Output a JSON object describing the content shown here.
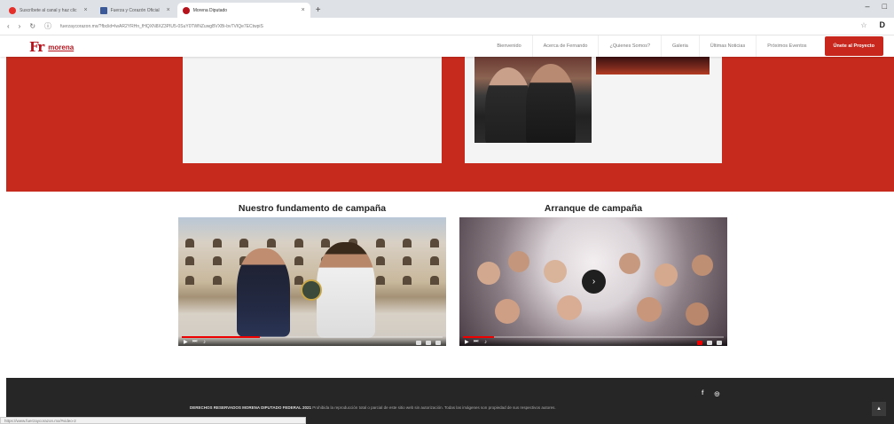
{
  "browser": {
    "tabs": [
      {
        "label": "Suscríbete al canal y haz clic",
        "favicon_color": "#e5302a",
        "active": false
      },
      {
        "label": "Fuerza y Corazón Oficial",
        "favicon_color": "#3b5998",
        "active": false
      },
      {
        "label": "Morena Diputado",
        "favicon_color": "#b5121b",
        "active": true
      }
    ],
    "new_tab": "+",
    "url": "fuerzaycorazon.mx/?fbclid=IwAR2YRHn_fHQXN8XZ3PIU5-0SuY0TWNZuwgBVXBi-bvTVIQe7ECtwpiS",
    "window_controls": [
      "–",
      "□"
    ],
    "profile_initial": "D"
  },
  "nav": {
    "logo_mark": "Fr",
    "logo_text": "morena",
    "items": [
      "Bienvenido",
      "Acerca de Fernando",
      "¿Quienes Somos?",
      "Galeria",
      "Últimas Noticias",
      "Próximos Eventos"
    ],
    "cta": "Únete al Proyecto"
  },
  "videos": [
    {
      "title": "Nuestro fundamento de campaña"
    },
    {
      "title": "Arranque de campaña"
    }
  ],
  "footer": {
    "social": [
      "f",
      "◎"
    ],
    "text_bold": "DERECHOS RESERVADOS MORENA DIPUTADO FEDERAL 2021",
    "text_rest": " Prohibida la reproducción total o parcial de este sitio web sin autorización. Todas las imágenes son propiedad de sus respectivos autores.",
    "top_button": "▲"
  },
  "status_bar": "https://www.fuerzaycorazon.mx/#video-2"
}
